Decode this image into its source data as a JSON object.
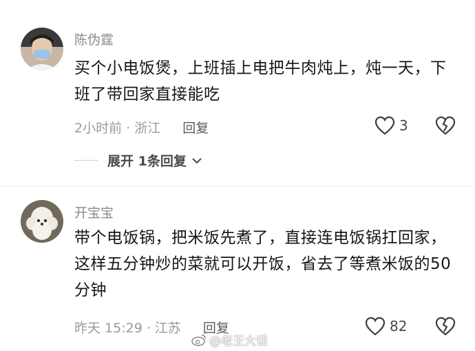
{
  "comments": [
    {
      "username": "陈伪霆",
      "text": "买个小电饭煲，上班插上电把牛肉炖上，炖一天，下班了带回家直接能吃",
      "time_location": "2小时前 · 浙江",
      "reply_label": "回复",
      "like_count": "3",
      "expand_label": "展开 1条回复"
    },
    {
      "username": "开宝宝",
      "text": "带个电饭锅，把米饭先煮了，直接连电饭锅扛回家，这样五分钟炒的菜就可以开饭，省去了等煮米饭的50分钟",
      "time_location": "昨天 15:29 · 江苏",
      "reply_label": "回复",
      "like_count": "82"
    }
  ],
  "watermark": "@老王大话",
  "icons": {
    "like": "heart-outline-icon",
    "dislike": "broken-heart-icon",
    "expand": "chevron-down-icon",
    "watermark_logo": "weibo-logo-icon"
  }
}
